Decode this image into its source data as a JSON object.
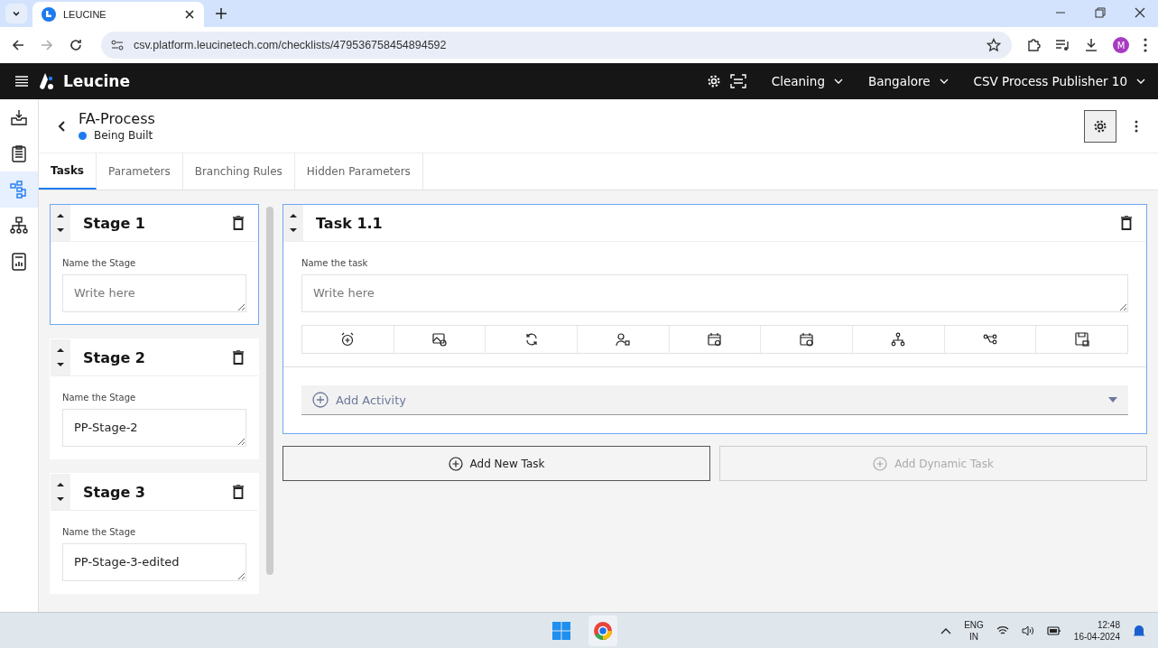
{
  "browser": {
    "tab_title": "LEUCINE",
    "url": "csv.platform.leucinetech.com/checklists/479536758454894592",
    "profile_initial": "M"
  },
  "app_header": {
    "brand": "Leucine",
    "dropdowns": [
      "Cleaning",
      "Bangalore",
      "CSV Process Publisher 10"
    ]
  },
  "sidebar": {
    "items": [
      {
        "kind": "inbox",
        "selected": false
      },
      {
        "kind": "checklist",
        "selected": false
      },
      {
        "kind": "flow",
        "selected": true
      },
      {
        "kind": "hierarchy",
        "selected": false
      },
      {
        "kind": "report",
        "selected": false
      }
    ]
  },
  "process": {
    "title": "FA-Process",
    "status": "Being Built"
  },
  "tabs": [
    {
      "label": "Tasks",
      "selected": true
    },
    {
      "label": "Parameters",
      "selected": false
    },
    {
      "label": "Branching Rules",
      "selected": false
    },
    {
      "label": "Hidden Parameters",
      "selected": false
    }
  ],
  "stages": [
    {
      "title": "Stage 1",
      "label": "Name the Stage",
      "placeholder": "Write here",
      "selected": true
    },
    {
      "title": "Stage 2",
      "label": "Name the Stage",
      "value": "PP-Stage-2",
      "selected": false
    },
    {
      "title": "Stage 3",
      "label": "Name the Stage",
      "value": "PP-Stage-3-edited",
      "selected": false
    }
  ],
  "task": {
    "title": "Task 1.1",
    "label": "Name the task",
    "placeholder": "Write here",
    "add_activity": "Add Activity"
  },
  "buttons": [
    {
      "label": "Add New Task",
      "disabled": false
    },
    {
      "label": "Add Dynamic Task",
      "disabled": true
    }
  ],
  "taskbar": {
    "language": "ENG",
    "region": "IN",
    "time": "12:48",
    "date": "16-04-2024"
  }
}
